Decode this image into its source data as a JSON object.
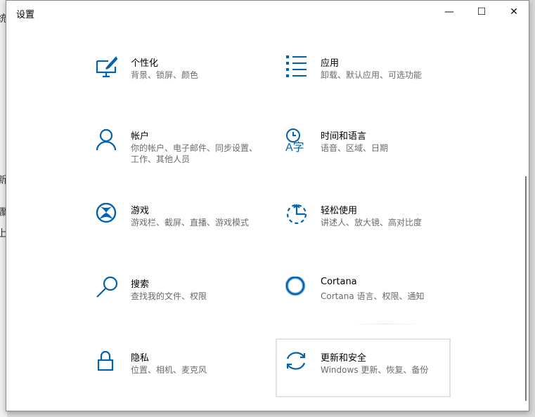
{
  "background_fragments": [
    "统",
    "新",
    "骤",
    "上"
  ],
  "window": {
    "title": "设置",
    "controls": {
      "minimize": "—",
      "maximize": "☐",
      "close": "✕"
    }
  },
  "accent": "#0063b1",
  "items": [
    {
      "icon": "personalization-icon",
      "title": "个性化",
      "desc": "背景、锁屏、颜色"
    },
    {
      "icon": "apps-icon",
      "title": "应用",
      "desc": "卸载、默认应用、可选功能"
    },
    {
      "icon": "account-icon",
      "title": "帐户",
      "desc": "你的帐户、电子邮件、同步设置、工作、其他人员"
    },
    {
      "icon": "time-language-icon",
      "title": "时间和语言",
      "desc": "语音、区域、日期"
    },
    {
      "icon": "xbox-icon",
      "title": "游戏",
      "desc": "游戏栏、截屏、直播、游戏模式"
    },
    {
      "icon": "ease-of-access-icon",
      "title": "轻松使用",
      "desc": "讲述人、放大镜、高对比度"
    },
    {
      "icon": "search-icon",
      "title": "搜索",
      "desc": "查找我的文件、权限"
    },
    {
      "icon": "cortana-icon",
      "title": "Cortana",
      "desc": "Cortana 语言、权限、通知"
    },
    {
      "icon": "lock-icon",
      "title": "隐私",
      "desc": "位置、相机、麦克风"
    },
    {
      "icon": "update-icon",
      "title": "更新和安全",
      "desc": "Windows 更新、恢复、备份"
    }
  ]
}
